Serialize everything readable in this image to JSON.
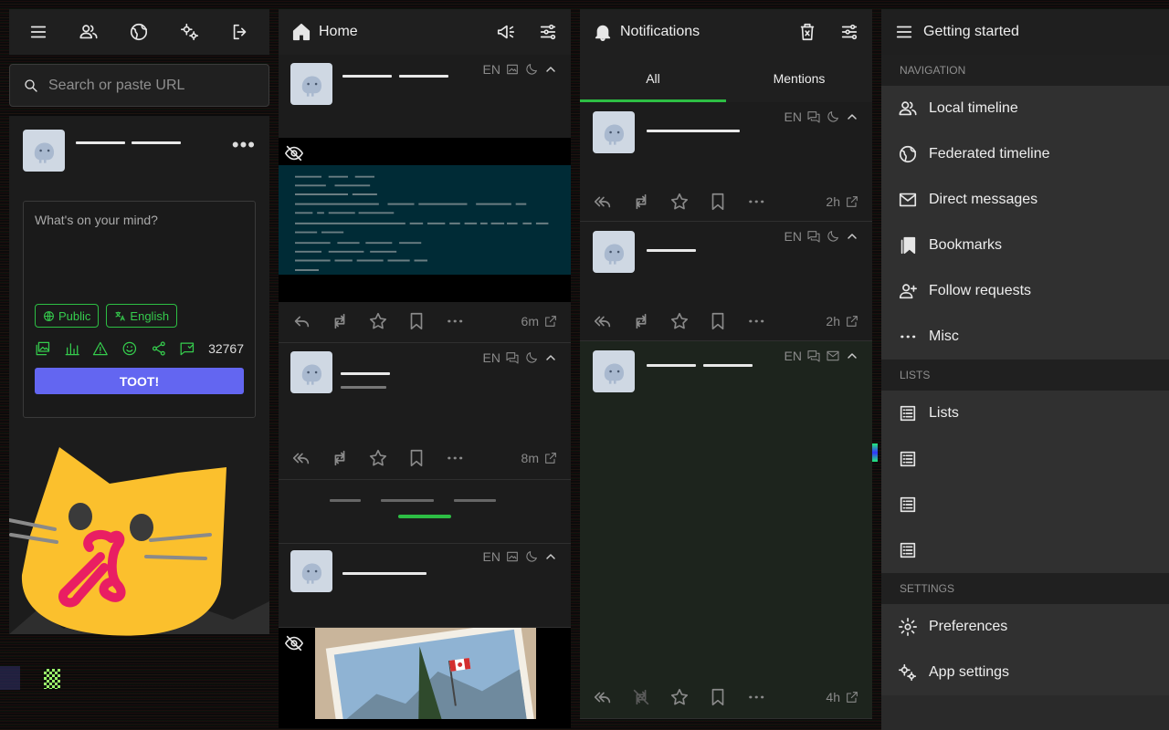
{
  "search": {
    "placeholder": "Search or paste URL"
  },
  "compose": {
    "placeholder": "What's on your mind?",
    "visibility": "Public",
    "language": "English",
    "char_count": "32767",
    "submit": "TOOT!"
  },
  "home": {
    "title": "Home",
    "posts": [
      {
        "lang": "EN",
        "time": "6m"
      },
      {
        "lang": "EN",
        "time": "8m"
      },
      {
        "lang": "EN",
        "time": ""
      }
    ]
  },
  "notifications": {
    "title": "Notifications",
    "tabs": [
      "All",
      "Mentions"
    ],
    "posts": [
      {
        "lang": "EN",
        "time": "2h"
      },
      {
        "lang": "EN",
        "time": "2h"
      },
      {
        "lang": "EN",
        "time": "4h"
      }
    ]
  },
  "getting_started": {
    "title": "Getting started",
    "navigation_header": "NAVIGATION",
    "navigation": [
      "Local timeline",
      "Federated timeline",
      "Direct messages",
      "Bookmarks",
      "Follow requests",
      "Misc"
    ],
    "lists_header": "LISTS",
    "lists": [
      "Lists",
      "",
      "",
      ""
    ],
    "settings_header": "SETTINGS",
    "settings": [
      "Preferences",
      "App settings"
    ]
  },
  "colors": {
    "accent": "#2dbe44",
    "button": "#6366f1",
    "panel": "#1c1c1c"
  }
}
